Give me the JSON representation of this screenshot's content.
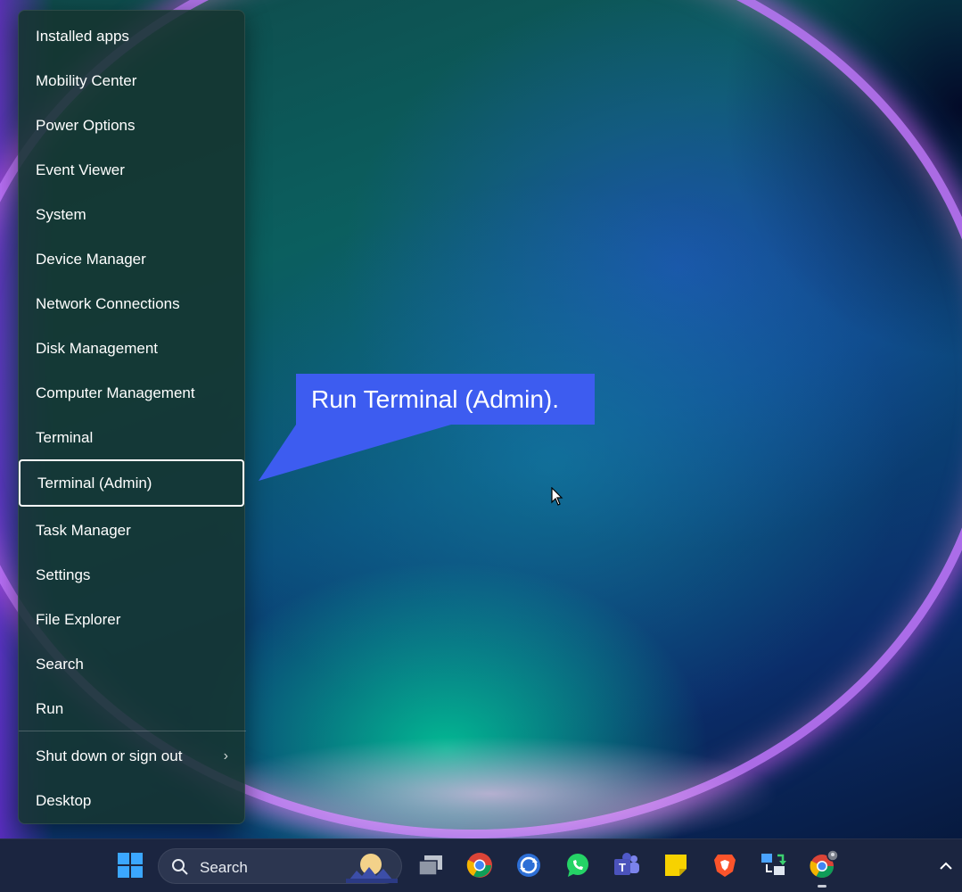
{
  "desktop": {
    "wallpaper": "windows-11-bloom-dark"
  },
  "context_menu": {
    "items": [
      {
        "label": "Installed apps"
      },
      {
        "label": "Mobility Center"
      },
      {
        "label": "Power Options"
      },
      {
        "label": "Event Viewer"
      },
      {
        "label": "System"
      },
      {
        "label": "Device Manager"
      },
      {
        "label": "Network Connections"
      },
      {
        "label": "Disk Management"
      },
      {
        "label": "Computer Management"
      },
      {
        "label": "Terminal"
      },
      {
        "label": "Terminal (Admin)",
        "selected": true
      },
      {
        "label": "Task Manager"
      },
      {
        "label": "Settings"
      },
      {
        "label": "File Explorer"
      },
      {
        "label": "Search"
      },
      {
        "label": "Run"
      },
      {
        "label": "Shut down or sign out",
        "submenu_icon": "chevron-right-icon"
      },
      {
        "label": "Desktop"
      }
    ]
  },
  "callout": {
    "text": "Run Terminal (Admin).",
    "color": "#3d5cf0"
  },
  "taskbar": {
    "search_label": "Search",
    "icons": [
      "windows-start-icon",
      "task-view-icon",
      "chrome-icon",
      "sync-app-icon",
      "whatsapp-icon",
      "teams-icon",
      "sticky-notes-icon",
      "brave-icon",
      "network-transfer-icon",
      "chrome-profile-icon"
    ],
    "overflow_icon": "chevron-up-icon",
    "accent": "#1b2540"
  }
}
